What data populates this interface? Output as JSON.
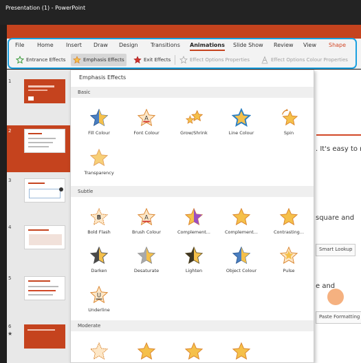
{
  "window": {
    "title": "Presentation (1) - PowerPoint"
  },
  "ribbon": {
    "tabs": [
      "File",
      "Home",
      "Insert",
      "Draw",
      "Design",
      "Transitions",
      "Animations",
      "Slide Show",
      "Review",
      "View",
      "Shape"
    ],
    "active_tab": "Animations",
    "commands": {
      "entrance": "Entrance Effects",
      "emphasis": "Emphasis Effects",
      "exit": "Exit Effects",
      "effect_options": "Effect Options Properties",
      "effect_options_colour": "Effect Options Colour Properties"
    }
  },
  "thumbnails": {
    "numbers": [
      "1",
      "2",
      "3",
      "4",
      "5",
      "6"
    ],
    "selected": "2"
  },
  "slide": {
    "line1": ". It's easy to m",
    "line2": "square and",
    "button1": "Smart Lookup",
    "line3": "e and",
    "button2": "Paste Formatting"
  },
  "gallery": {
    "title": "Emphasis Effects",
    "sections": {
      "basic": "Basic",
      "subtle": "Subtle",
      "moderate": "Moderate"
    },
    "basic": [
      {
        "label": "Fill Colour",
        "icon": "star-fill-colour-icon"
      },
      {
        "label": "Font Colour",
        "icon": "star-font-colour-icon"
      },
      {
        "label": "Grow/Shrink",
        "icon": "star-grow-shrink-icon"
      },
      {
        "label": "Line Colour",
        "icon": "star-line-colour-icon"
      },
      {
        "label": "Spin",
        "icon": "star-spin-icon"
      },
      {
        "label": "Transparency",
        "icon": "star-transparency-icon"
      }
    ],
    "subtle": [
      {
        "label": "Bold Flash",
        "icon": "star-bold-flash-icon"
      },
      {
        "label": "Brush Colour",
        "icon": "star-brush-colour-icon"
      },
      {
        "label": "Complement...",
        "icon": "star-complementary-icon"
      },
      {
        "label": "Complement...",
        "icon": "star-complementary-2-icon"
      },
      {
        "label": "Contrasting...",
        "icon": "star-contrasting-icon"
      },
      {
        "label": "Darken",
        "icon": "star-darken-icon"
      },
      {
        "label": "Desaturate",
        "icon": "star-desaturate-icon"
      },
      {
        "label": "Lighten",
        "icon": "star-lighten-icon"
      },
      {
        "label": "Object Colour",
        "icon": "star-object-colour-icon"
      },
      {
        "label": "Pulse",
        "icon": "star-pulse-icon"
      },
      {
        "label": "Underline",
        "icon": "star-underline-icon"
      }
    ],
    "moderate_partial_icons": [
      "star-moderate-1-icon",
      "star-moderate-2-icon",
      "star-moderate-3-icon",
      "star-moderate-4-icon"
    ],
    "star_letter_B": "B",
    "star_letter_A": "A",
    "star_letter_U": "U"
  },
  "colors": {
    "accent": "#c5431e",
    "highlight": "#1aa0e0",
    "star_gold": "#f5c04a",
    "star_outline": "#d9832b",
    "entrance_green": "#3c9a3c",
    "exit_red": "#d0312d"
  }
}
